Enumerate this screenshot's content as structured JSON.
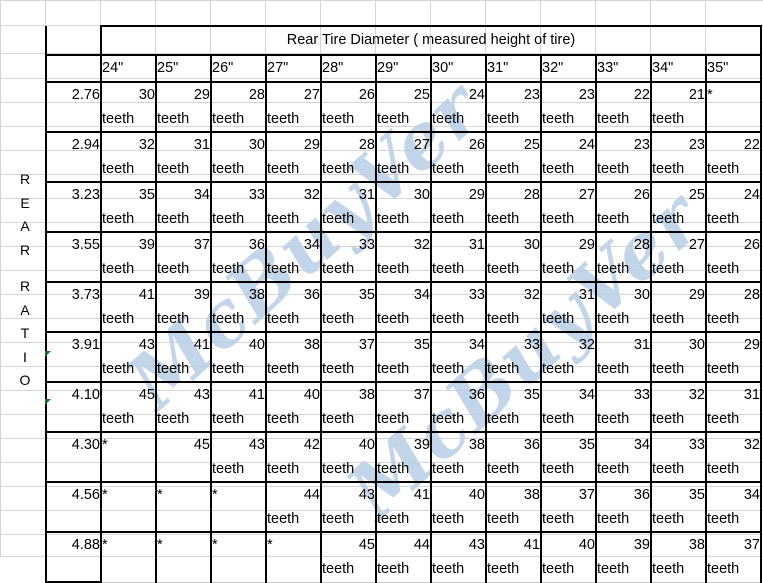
{
  "table": {
    "header_title": "Rear Tire Diameter ( measured height of tire)",
    "corner_blank": "",
    "side_label": "REAR RATIO",
    "side_label_chars_top": [
      "R",
      "E",
      "A",
      "R"
    ],
    "side_label_chars_bottom": [
      "R",
      "A",
      "T",
      "I",
      "O"
    ],
    "unit_label": "teeth",
    "unavailable_marker": "*",
    "columns": [
      "24\"",
      "25\"",
      "26\"",
      "27\"",
      "28\"",
      "29\"",
      "30\"",
      "31\"",
      "32\"",
      "33\"",
      "34\"",
      "35\""
    ],
    "row_header_label": "",
    "rows": [
      {
        "ratio": "2.76",
        "values": [
          "30",
          "29",
          "28",
          "27",
          "26",
          "25",
          "24",
          "23",
          "23",
          "22",
          "21",
          "*"
        ],
        "units": [
          "teeth",
          "teeth",
          "teeth",
          "teeth",
          "teeth",
          "teeth",
          "teeth",
          "teeth",
          "teeth",
          "teeth",
          "teeth",
          ""
        ]
      },
      {
        "ratio": "2.94",
        "values": [
          "32",
          "31",
          "30",
          "29",
          "28",
          "27",
          "26",
          "25",
          "24",
          "23",
          "23",
          "22"
        ],
        "units": [
          "teeth",
          "teeth",
          "teeth",
          "teeth",
          "teeth",
          "teeth",
          "teeth",
          "teeth",
          "teeth",
          "teeth",
          "teeth",
          "teeth"
        ]
      },
      {
        "ratio": "3.23",
        "values": [
          "35",
          "34",
          "33",
          "32",
          "31",
          "30",
          "29",
          "28",
          "27",
          "26",
          "25",
          "24"
        ],
        "units": [
          "teeth",
          "teeth",
          "teeth",
          "teeth",
          "teeth",
          "teeth",
          "teeth",
          "teeth",
          "teeth",
          "teeth",
          "teeth",
          "teeth"
        ]
      },
      {
        "ratio": "3.55",
        "values": [
          "39",
          "37",
          "36",
          "34",
          "33",
          "32",
          "31",
          "30",
          "29",
          "28",
          "27",
          "26"
        ],
        "units": [
          "teeth",
          "teeth",
          "teeth",
          "teeth",
          "teeth",
          "teeth",
          "teeth",
          "teeth",
          "teeth",
          "teeth",
          "teeth",
          "teeth"
        ]
      },
      {
        "ratio": "3.73",
        "values": [
          "41",
          "39",
          "38",
          "36",
          "35",
          "34",
          "33",
          "32",
          "31",
          "30",
          "29",
          "28"
        ],
        "units": [
          "teeth",
          "teeth",
          "teeth",
          "teeth",
          "teeth",
          "teeth",
          "teeth",
          "teeth",
          "teeth",
          "teeth",
          "teeth",
          "teeth"
        ]
      },
      {
        "ratio": "3.91",
        "values": [
          "43",
          "41",
          "40",
          "38",
          "37",
          "35",
          "34",
          "33",
          "32",
          "31",
          "30",
          "29"
        ],
        "units": [
          "teeth",
          "teeth",
          "teeth",
          "teeth",
          "teeth",
          "teeth",
          "teeth",
          "teeth",
          "teeth",
          "teeth",
          "teeth",
          "teeth"
        ]
      },
      {
        "ratio": "4.10",
        "values": [
          "45",
          "43",
          "41",
          "40",
          "38",
          "37",
          "36",
          "35",
          "34",
          "33",
          "32",
          "31"
        ],
        "units": [
          "teeth",
          "teeth",
          "teeth",
          "teeth",
          "teeth",
          "teeth",
          "teeth",
          "teeth",
          "teeth",
          "teeth",
          "teeth",
          "teeth"
        ]
      },
      {
        "ratio": "4.30",
        "values": [
          "*",
          "45",
          "43",
          "42",
          "40",
          "39",
          "38",
          "36",
          "35",
          "34",
          "33",
          "32"
        ],
        "units": [
          "",
          "",
          "teeth",
          "teeth",
          "teeth",
          "teeth",
          "teeth",
          "teeth",
          "teeth",
          "teeth",
          "teeth",
          "teeth"
        ]
      },
      {
        "ratio": "4.56",
        "values": [
          "*",
          "*",
          "*",
          "44",
          "43",
          "41",
          "40",
          "38",
          "37",
          "36",
          "35",
          "34"
        ],
        "units": [
          "",
          "",
          "",
          "teeth",
          "teeth",
          "teeth",
          "teeth",
          "teeth",
          "teeth",
          "teeth",
          "teeth",
          "teeth"
        ]
      },
      {
        "ratio": "4.88",
        "values": [
          "*",
          "*",
          "*",
          "*",
          "45",
          "44",
          "43",
          "41",
          "40",
          "39",
          "38",
          "37"
        ],
        "units": [
          "",
          "",
          "",
          "",
          "teeth",
          "teeth",
          "teeth",
          "teeth",
          "teeth",
          "teeth",
          "teeth",
          "teeth"
        ]
      }
    ]
  },
  "watermark": {
    "text_a": "McBuyVer",
    "text_b": "McBuyVer",
    "color": "#b9cfe6"
  },
  "colors": {
    "grid_line": "#d4d4d4",
    "border": "#000000",
    "background": "#ffffff",
    "flag": "#0a7a25"
  }
}
